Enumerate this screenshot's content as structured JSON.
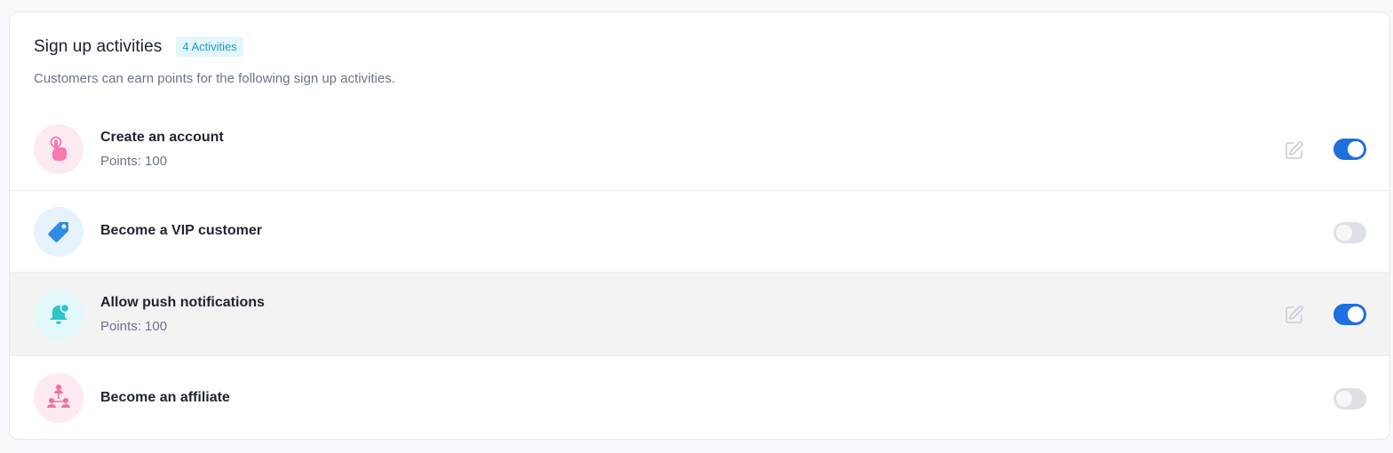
{
  "header": {
    "title": "Sign up activities",
    "badge": "4 Activities",
    "subtitle": "Customers can earn points for the following sign up activities."
  },
  "activities": [
    {
      "label": "Create an account",
      "points": "Points: 100",
      "icon": "hand-pointer-icon",
      "enabled": true,
      "editable": true
    },
    {
      "label": "Become a VIP customer",
      "points": "",
      "icon": "tag-icon",
      "enabled": false,
      "editable": false
    },
    {
      "label": "Allow push notifications",
      "points": "Points: 100",
      "icon": "bell-icon",
      "enabled": true,
      "editable": true
    },
    {
      "label": "Become an affiliate",
      "points": "",
      "icon": "affiliate-network-icon",
      "enabled": false,
      "editable": false
    }
  ],
  "colors": {
    "toggle_on": "#1e6fe0",
    "toggle_off": "#dde1e6",
    "badge_bg": "#e3f6fb",
    "badge_text": "#1b9cc4"
  }
}
